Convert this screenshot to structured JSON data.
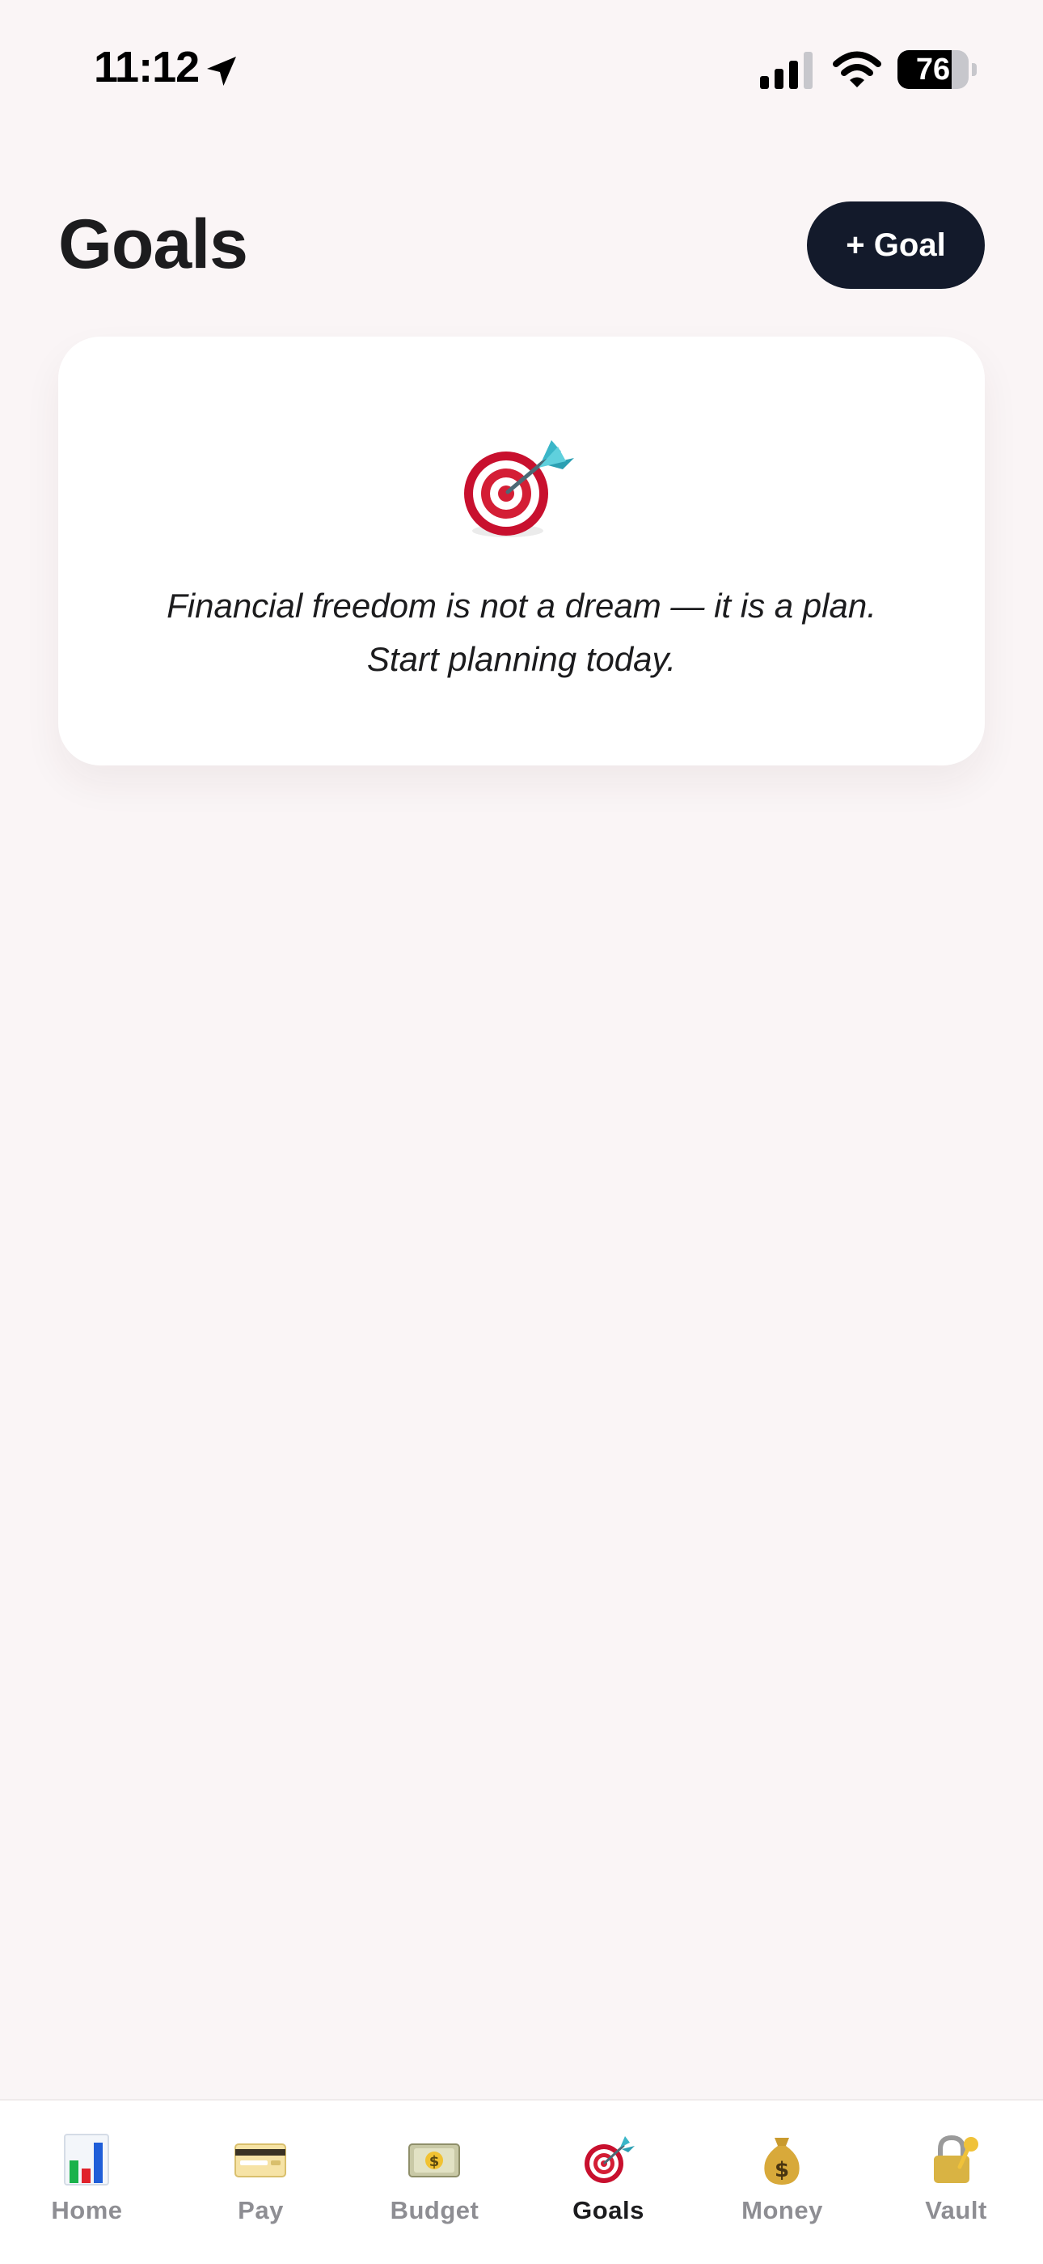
{
  "status_bar": {
    "time": "11:12",
    "battery": "76",
    "battery_level": 0.76
  },
  "header": {
    "title": "Goals",
    "add_button_label": "+ Goal"
  },
  "empty_state": {
    "icon": "target-dart-icon",
    "quote_line_1": "Financial freedom is not a dream — it is a plan.",
    "quote_line_2": "Start planning today."
  },
  "tab_bar": {
    "active": "Goals",
    "tabs": [
      {
        "label": "Home",
        "icon": "bar-chart-icon"
      },
      {
        "label": "Pay",
        "icon": "credit-card-icon"
      },
      {
        "label": "Budget",
        "icon": "dollar-banknote-icon"
      },
      {
        "label": "Goals",
        "icon": "target-dart-icon"
      },
      {
        "label": "Money",
        "icon": "money-bag-icon"
      },
      {
        "label": "Vault",
        "icon": "lock-with-key-icon"
      }
    ]
  },
  "colors": {
    "background": "#faf5f6",
    "primary_button": "#131a2b",
    "inactive_tab": "#8e8e93",
    "active_tab": "#1c1c1e"
  }
}
